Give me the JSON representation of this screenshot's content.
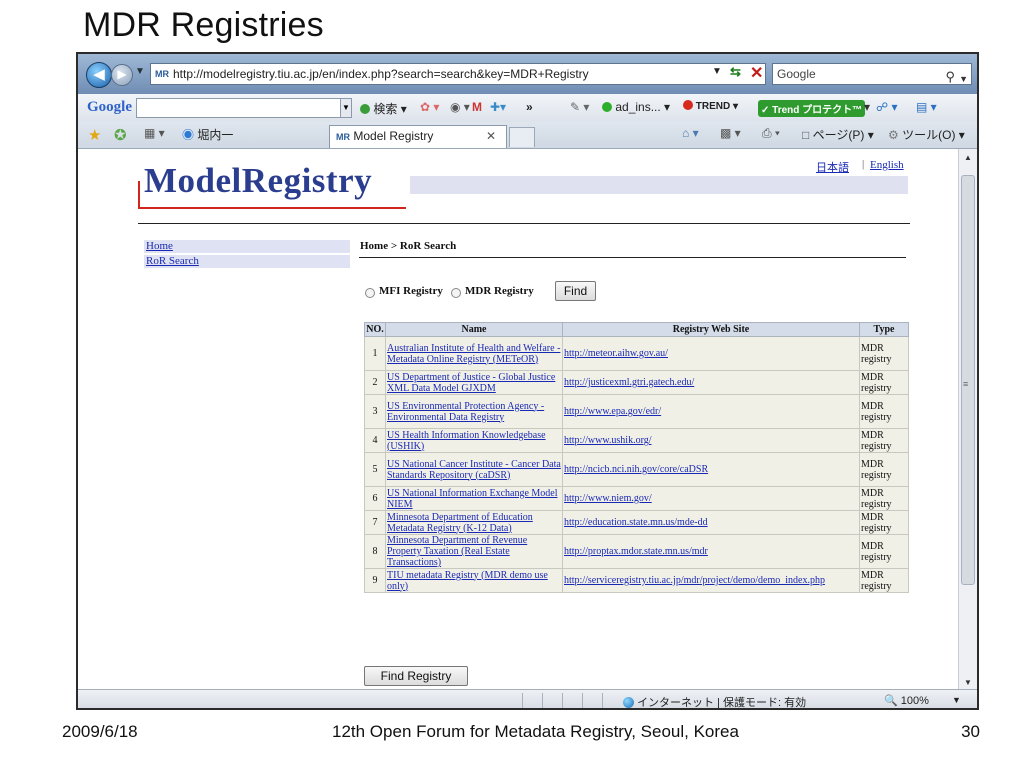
{
  "slide": {
    "title": "MDR Registries",
    "footer_date": "2009/6/18",
    "footer_center": "12th Open Forum for Metadata Registry, Seoul, Korea",
    "page_number": "30"
  },
  "browser": {
    "address": "http://modelregistry.tiu.ac.jp/en/index.php?search=search&key=MDR+Registry",
    "favicon_text": "MR",
    "search_placeholder": "Google",
    "toolbar": {
      "google_label": "Google",
      "search_label": "検索",
      "more_label": "»",
      "ad_label": "ad_ins...",
      "trend_label": "TREND",
      "trend_protect_label": "Trend プロテクト™"
    },
    "tabs": {
      "prev_tab_label": "堀内一",
      "active_tab_label": "Model Registry",
      "commands_label": "ページ(P)",
      "tools_label": "ツール(O)"
    },
    "status": {
      "zone_text": "インターネット | 保護モード: 有効",
      "zoom": "100%"
    }
  },
  "page": {
    "logo": "ModelRegistry",
    "lang_ja": "日本語",
    "lang_sep": "|",
    "lang_en": "English",
    "sidebar": [
      {
        "label": "Home"
      },
      {
        "label": "RoR Search"
      }
    ],
    "breadcrumb": "Home > RoR Search",
    "radio_mfi": "MFI Registry",
    "radio_mdr": "MDR Registry",
    "find_label": "Find",
    "find_registry_label": "Find Registry",
    "table": {
      "headers": [
        "NO.",
        "Name",
        "Registry Web Site",
        "Type"
      ],
      "rows": [
        {
          "no": "1",
          "name": "Australian Institute of Health and Welfare - Metadata Online Registry (METeOR)",
          "site": "http://meteor.aihw.gov.au/",
          "type": "MDR registry"
        },
        {
          "no": "2",
          "name": "US Department of Justice - Global Justice XML Data Model GJXDM",
          "site": "http://justicexml.gtri.gatech.edu/",
          "type": "MDR registry"
        },
        {
          "no": "3",
          "name": "US Environmental Protection Agency - Environmental Data Registry",
          "site": "http://www.epa.gov/edr/",
          "type": "MDR registry"
        },
        {
          "no": "4",
          "name": "US Health Information Knowledgebase (USHIK)",
          "site": "http://www.ushik.org/",
          "type": "MDR registry"
        },
        {
          "no": "5",
          "name": "US National Cancer Institute - Cancer Data Standards Repository (caDSR)",
          "site": "http://ncicb.nci.nih.gov/core/caDSR",
          "type": "MDR registry"
        },
        {
          "no": "6",
          "name": "US National Information Exchange Model NIEM",
          "site": "http://www.niem.gov/",
          "type": "MDR registry"
        },
        {
          "no": "7",
          "name": "Minnesota Department of Education Metadata Registry (K-12 Data)",
          "site": "http://education.state.mn.us/mde-dd",
          "type": "MDR registry"
        },
        {
          "no": "8",
          "name": "Minnesota Department of Revenue Property Taxation (Real Estate Transactions)",
          "site": "http://proptax.mdor.state.mn.us/mdr",
          "type": "MDR registry"
        },
        {
          "no": "9",
          "name": "TIU metadata Registry (MDR demo use only)",
          "site": "http://serviceregistry.tiu.ac.jp/mdr/project/demo/demo_index.php",
          "type": "MDR registry"
        }
      ]
    }
  }
}
